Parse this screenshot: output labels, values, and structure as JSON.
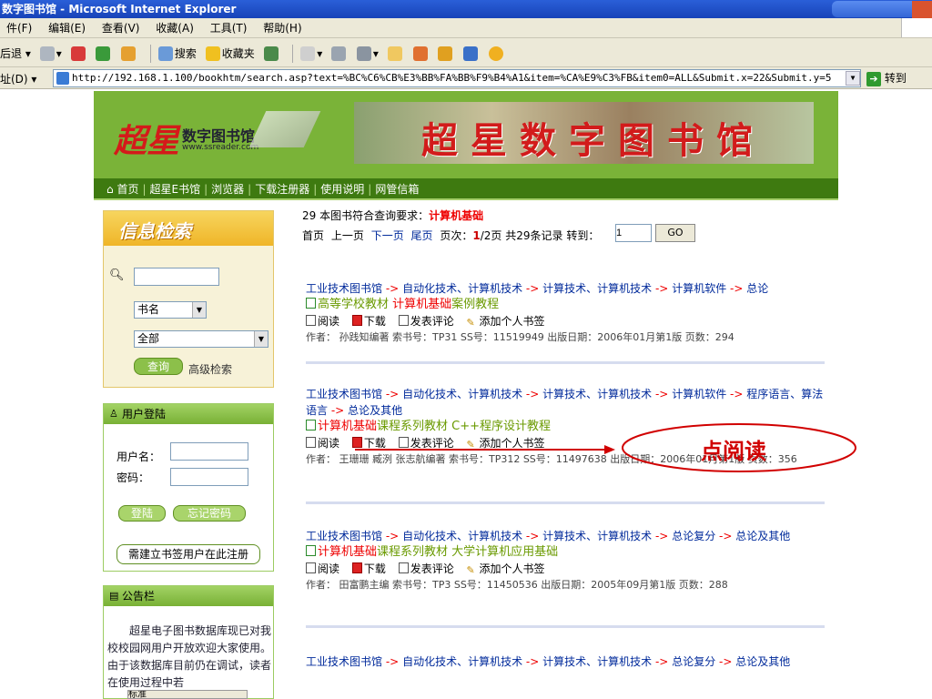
{
  "window": {
    "title": "数字图书馆 - Microsoft Internet Explorer"
  },
  "menu": [
    "件(F)",
    "编辑(E)",
    "查看(V)",
    "收藏(A)",
    "工具(T)",
    "帮助(H)"
  ],
  "toolbar": {
    "back": "后退",
    "search": "搜索",
    "favorites": "收藏夹"
  },
  "address": {
    "label": "址(D)",
    "url": "http://192.168.1.100/bookhtm/search.asp?text=%BC%C6%CB%E3%BB%FA%BB%F9%B4%A1&item=%CA%E9%C3%FB&item0=ALL&Submit.x=22&Submit.y=5",
    "go": "转到"
  },
  "banner": {
    "logo_cn": "超星",
    "logo_sub": "数字图书馆",
    "logo_url": "www.ssreader.com",
    "photo_text": "超星数字图书馆"
  },
  "nav": [
    "首页",
    "超星E书馆",
    "浏览器",
    "下载注册器",
    "使用说明",
    "网管信箱"
  ],
  "search_panel": {
    "title": "信息检索",
    "field_select": "书名",
    "scope_select": "全部",
    "query_btn": "查询",
    "advanced": "高级检索"
  },
  "login_panel": {
    "title": "用户登陆",
    "username_label": "用户名：",
    "password_label": "密码：",
    "login_btn": "登陆",
    "forgot_btn": "忘记密码",
    "register_btn": "需建立书签用户在此注册"
  },
  "notice_panel": {
    "title": "公告栏",
    "text": "超星电子图书数据库现已对我校校园网用户开放欢迎大家使用。由于该数据库目前仍在调试，读者在使用过程中若"
  },
  "results": {
    "summary_prefix": "29 本图书符合查询要求：",
    "query": "计算机基础",
    "pager": {
      "first": "首页",
      "prev": "上一页",
      "next": "下一页",
      "last": "尾页",
      "page_label": "页次：",
      "page_current": "1",
      "page_total": "/2页",
      "total": "共29条记录",
      "goto_label": "转到：",
      "goto_value": "1",
      "go_btn": "GO"
    },
    "actions": {
      "read": "阅读",
      "download": "下载",
      "comment": "发表评论",
      "bookmark": "添加个人书签"
    },
    "items": [
      {
        "category": [
          "工业技术图书馆",
          "自动化技术、计算机技术",
          "计算技术、计算机技术",
          "计算机软件",
          "总论"
        ],
        "title_pre": "高等学校教材 ",
        "title_hl": "计算机基础",
        "title_post": "案例教程",
        "meta": "作者： 孙践知编著 索书号：TP31  SS号：11519949   出版日期：2006年01月第1版  页数：294"
      },
      {
        "category": [
          "工业技术图书馆",
          "自动化技术、计算机技术",
          "计算技术、计算机技术",
          "计算机软件",
          "程序语言、算法语言",
          "总论及其他"
        ],
        "title_pre": "",
        "title_hl": "计算机基础",
        "title_post": "课程系列教材 C++程序设计教程",
        "meta": "作者： 王珊珊 臧洌 张志航编著 索书号：TP312  SS号：11497638   出版日期：2006年01月第1版  页数：356"
      },
      {
        "category": [
          "工业技术图书馆",
          "自动化技术、计算机技术",
          "计算技术、计算机技术",
          "总论复分",
          "总论及其他"
        ],
        "title_pre": "",
        "title_hl": "计算机基础",
        "title_post": "课程系列教材 大学计算机应用基础",
        "meta": "作者： 田富鹏主编 索书号：TP3  SS号：11450536   出版日期：2005年09月第1版  页数：288"
      },
      {
        "category": [
          "工业技术图书馆",
          "自动化技术、计算机技术",
          "计算技术、计算机技术",
          "总论复分",
          "总论及其他"
        ],
        "title_pre": "",
        "title_hl": "",
        "title_post": "",
        "meta": ""
      }
    ]
  },
  "annotation": {
    "text": "点阅读",
    "color": "#d10000"
  },
  "status": {
    "text": "标准"
  }
}
